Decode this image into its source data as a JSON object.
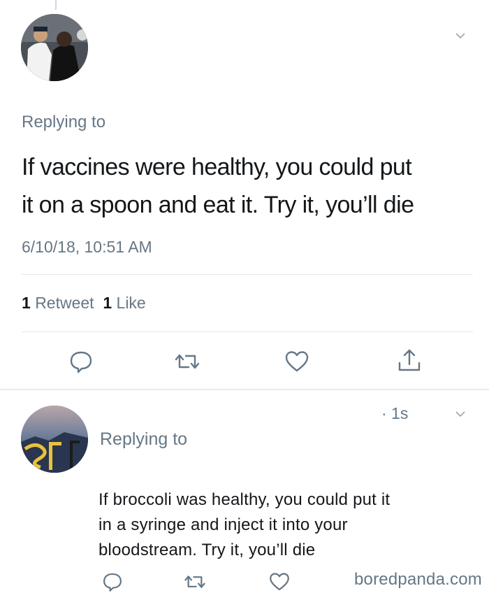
{
  "colors": {
    "icon_gray": "#657786",
    "text_dark": "#14171a",
    "divider": "#e1e8ed"
  },
  "tweet1": {
    "replying_to": "Replying to",
    "text": "If vaccines were healthy, you could put\nit on a spoon and eat it. Try it, you’ll die",
    "timestamp": "6/10/18, 10:51 AM",
    "retweet_count": "1",
    "retweet_label": "Retweet",
    "like_count": "1",
    "like_label": "Like",
    "actions": [
      "reply-icon",
      "retweet-icon",
      "like-icon",
      "share-icon"
    ]
  },
  "tweet2": {
    "time": "· 1s",
    "replying_to": "Replying to",
    "text_lines": [
      "If broccoli was healthy, you could put it",
      "in a syringe and inject it into your",
      "bloodstream. Try it, you’ll die"
    ],
    "actions": [
      "reply-icon",
      "retweet-icon",
      "like-icon"
    ]
  },
  "watermark": "boredpanda.com"
}
